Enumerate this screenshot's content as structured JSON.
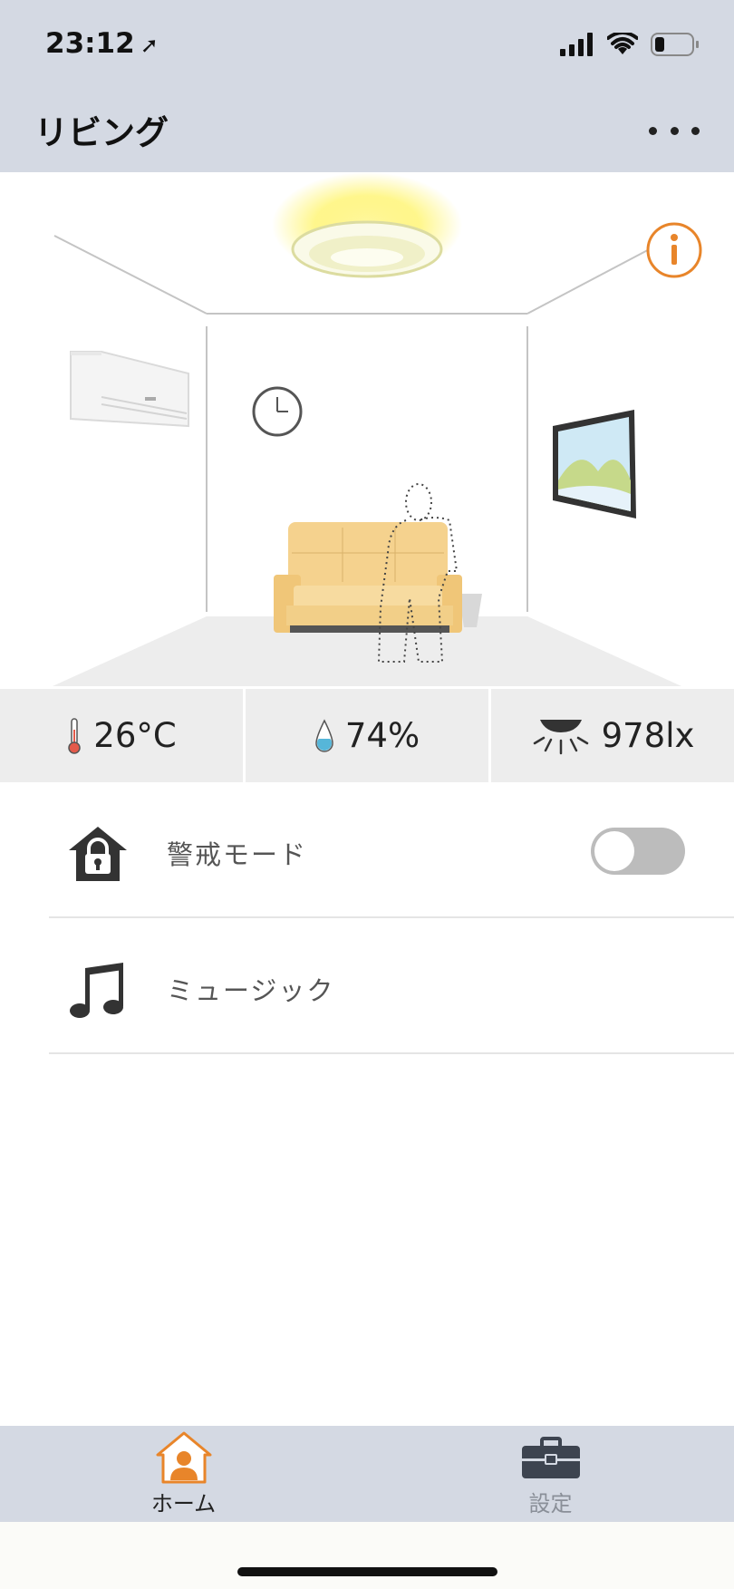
{
  "status_bar": {
    "time": "23:12",
    "location_icon": "location-arrow-icon",
    "signal_icon": "cellular-signal-icon",
    "wifi_icon": "wifi-icon",
    "battery_icon": "battery-icon",
    "battery_level": 0.25
  },
  "nav": {
    "title": "リビング",
    "more_icon": "more-dots-icon"
  },
  "room": {
    "info_icon": "info-icon",
    "accent_color": "#e8852a",
    "light_on": true
  },
  "sensors": [
    {
      "icon": "thermometer-icon",
      "value": "26°C"
    },
    {
      "icon": "humidity-drop-icon",
      "value": "74%"
    },
    {
      "icon": "ceiling-light-icon",
      "value": "978lx"
    }
  ],
  "list": {
    "items": [
      {
        "icon": "lock-house-icon",
        "label": "警戒モード",
        "toggle_on": false
      },
      {
        "icon": "music-note-icon",
        "label": "ミュージック"
      }
    ]
  },
  "tabs": [
    {
      "icon": "home-person-icon",
      "label": "ホーム",
      "active": true,
      "color": "#e8852a"
    },
    {
      "icon": "toolbox-icon",
      "label": "設定",
      "active": false,
      "color": "#3d4450"
    }
  ]
}
